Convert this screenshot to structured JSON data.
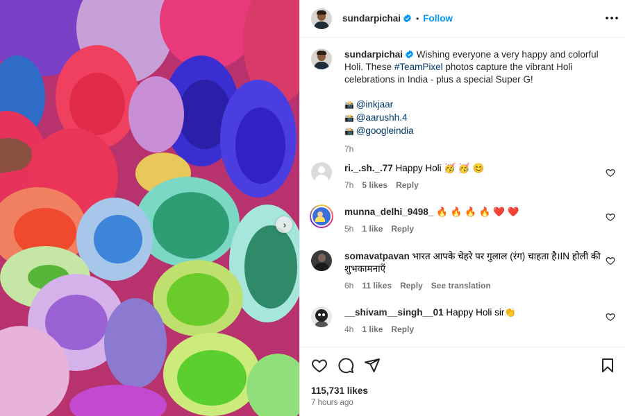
{
  "photo": {
    "alt_icon": "chevron-right-icon"
  },
  "post": {
    "author": "sundarpichai",
    "follow_label": "Follow",
    "separator": "•",
    "more_icon": "•••"
  },
  "caption": {
    "author": "sundarpichai",
    "text_before": " Wishing everyone a very happy and colorful Holi. These ",
    "hashtag": "#TeamPixel",
    "text_after": " photos capture the vibrant Holi celebrations in India - plus a special Super G!",
    "credits": [
      {
        "icon": "📸",
        "handle": "@inkjaar"
      },
      {
        "icon": "📸",
        "handle": "@aarushh.4"
      },
      {
        "icon": "📸",
        "handle": "@googleindia"
      }
    ],
    "time": "7h"
  },
  "comments": [
    {
      "user": "ri._.sh._.77",
      "text": " Happy Holi 🥳 🥳 😊",
      "time": "7h",
      "likes": "5 likes",
      "reply": "Reply"
    },
    {
      "user": "munna_delhi_9498_",
      "text": " 🔥 🔥 🔥 🔥 ❤️ ❤️",
      "time": "5h",
      "likes": "1 like",
      "reply": "Reply"
    },
    {
      "user": "somavatpavan",
      "text": " भारत आपके चेहरे पर गुलाल (रंग) चाहता है।IN होली की शुभकामनाएँ",
      "time": "6h",
      "likes": "11 likes",
      "reply": "Reply",
      "translate": "See translation"
    },
    {
      "user": "__shivam__singh__01",
      "text": " Happy Holi sir👏",
      "time": "4h",
      "likes": "1 like",
      "reply": "Reply"
    }
  ],
  "footer": {
    "likes": "115,731 likes",
    "posted": "7 hours ago"
  },
  "colors": {
    "accent": "#0095f6",
    "link": "#00376b",
    "muted": "#737373",
    "border": "#efefef"
  }
}
